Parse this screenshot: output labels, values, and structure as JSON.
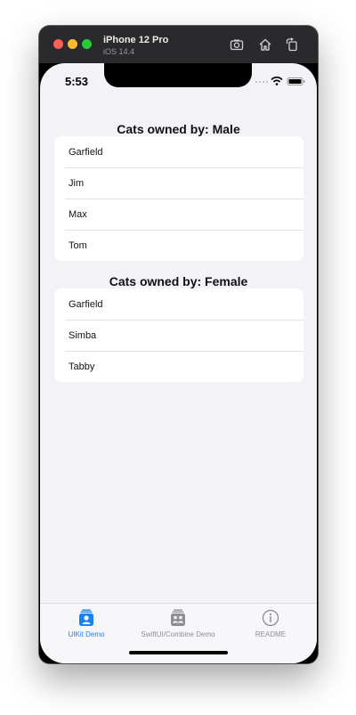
{
  "simulator": {
    "device_name": "iPhone 12 Pro",
    "os_version": "iOS 14.4"
  },
  "status_bar": {
    "time": "5:53"
  },
  "sections": [
    {
      "title": "Cats owned by: Male",
      "items": [
        "Garfield",
        "Jim",
        "Max",
        "Tom"
      ]
    },
    {
      "title": "Cats owned by: Female",
      "items": [
        "Garfield",
        "Simba",
        "Tabby"
      ]
    }
  ],
  "tab_bar": {
    "tabs": [
      {
        "label": "UIKit Demo",
        "icon": "person-badge-icon",
        "active": true
      },
      {
        "label": "SwiftUI/Combine Demo",
        "icon": "people-badge-icon",
        "active": false
      },
      {
        "label": "README",
        "icon": "info-circle-icon",
        "active": false
      }
    ]
  },
  "colors": {
    "accent": "#1a82f7",
    "inactive": "#8e8e93",
    "background": "#f2f2f7"
  }
}
